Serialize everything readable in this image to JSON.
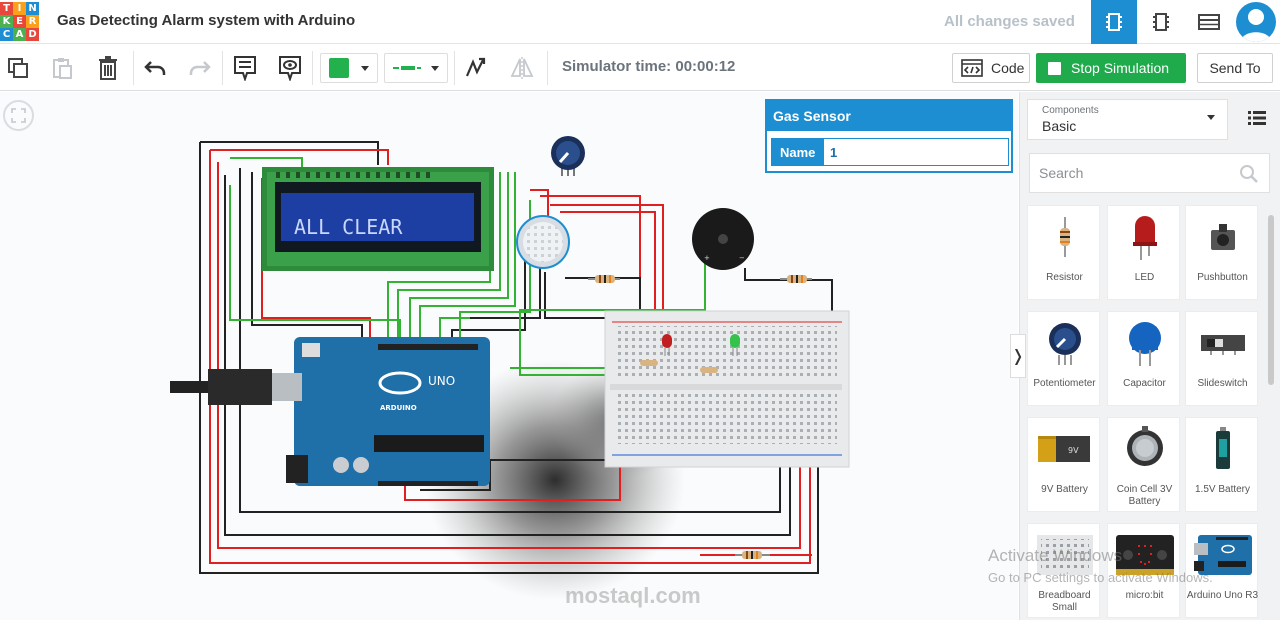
{
  "header": {
    "logo_letters": [
      "T",
      "I",
      "N",
      "K",
      "E",
      "R",
      "C",
      "A",
      "D"
    ],
    "logo_colors": [
      "#e8473b",
      "#f9a11b",
      "#1c8ed1",
      "#4caf50",
      "#e8473b",
      "#f9a11b",
      "#1c8ed1",
      "#4caf50",
      "#e8473b"
    ],
    "title": "Gas Detecting Alarm system with Arduino",
    "save_status": "All changes saved",
    "views": [
      {
        "name": "circuit-view-icon",
        "active": true
      },
      {
        "name": "schematic-view-icon",
        "active": false
      },
      {
        "name": "component-list-icon",
        "active": false
      }
    ]
  },
  "toolbar": {
    "sim_time_label": "Simulator time: 00:00:12",
    "code_label": "Code",
    "stop_label": "Stop Simulation",
    "send_label": "Send To",
    "wire_color": "#22b14c"
  },
  "inspector": {
    "title": "Gas Sensor",
    "name_label": "Name",
    "name_value": "1"
  },
  "canvas": {
    "lcd_text": "ALL CLEAR",
    "board_brand": "ARDUINO",
    "board_model": "UNO"
  },
  "panel": {
    "components_label": "Components",
    "components_value": "Basic",
    "search_placeholder": "Search",
    "items": [
      {
        "label": "Resistor"
      },
      {
        "label": "LED"
      },
      {
        "label": "Pushbutton"
      },
      {
        "label": "Potentiometer"
      },
      {
        "label": "Capacitor"
      },
      {
        "label": "Slideswitch"
      },
      {
        "label": "9V Battery"
      },
      {
        "label": "Coin Cell 3V Battery"
      },
      {
        "label": "1.5V Battery"
      },
      {
        "label": "Breadboard Small"
      },
      {
        "label": "micro:bit"
      },
      {
        "label": "Arduino Uno R3"
      }
    ]
  },
  "overlay": {
    "activate_title": "Activate Windows",
    "activate_sub": "Go to PC settings to activate Windows.",
    "mostaql": "mostaql.com"
  },
  "colors": {
    "accent": "#1c8ed1",
    "stop_green": "#1faa4c",
    "wire_red": "#e02020",
    "wire_black": "#222222",
    "wire_green": "#34b233"
  }
}
